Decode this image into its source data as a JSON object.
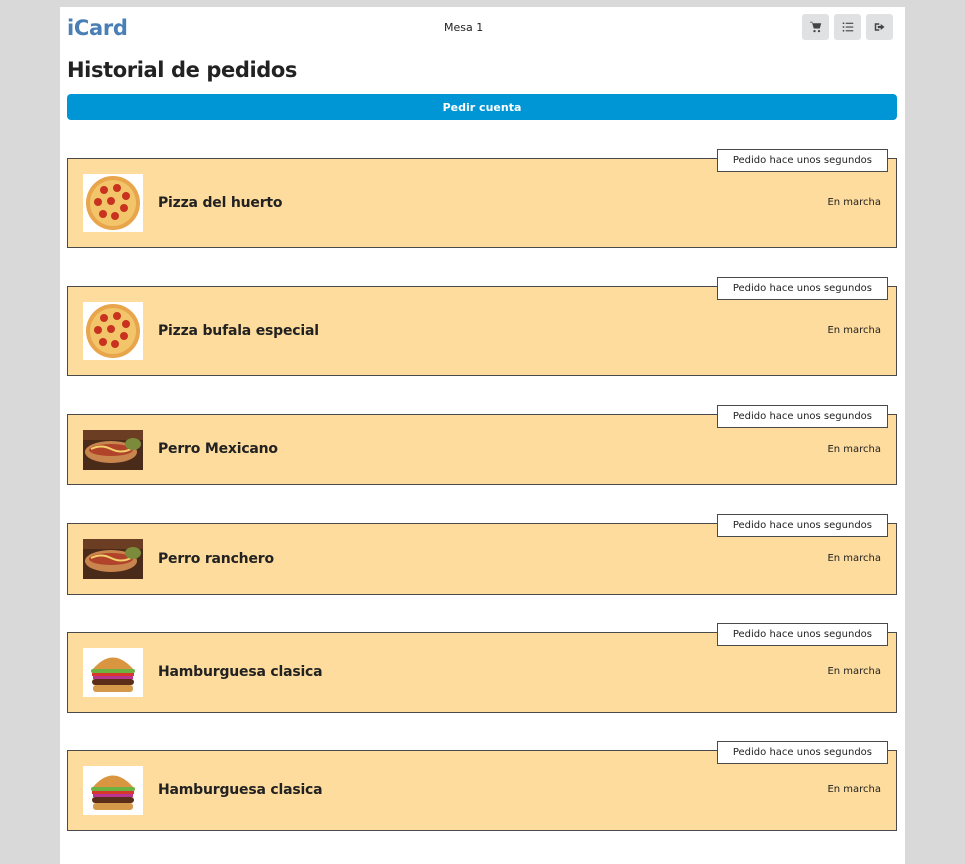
{
  "header": {
    "brand": "iCard",
    "table": "Mesa 1",
    "icons": [
      "cart-icon",
      "list-icon",
      "logout-icon"
    ]
  },
  "page_title": "Historial de pedidos",
  "pay_button_label": "Pedir cuenta",
  "orders": [
    {
      "name": "Pizza del huerto",
      "status": "En marcha",
      "time": "Pedido hace unos segundos",
      "image": "pizza"
    },
    {
      "name": "Pizza bufala especial",
      "status": "En marcha",
      "time": "Pedido hace unos segundos",
      "image": "pizza"
    },
    {
      "name": "Perro Mexicano",
      "status": "En marcha",
      "time": "Pedido hace unos segundos",
      "image": "hotdog"
    },
    {
      "name": "Perro ranchero",
      "status": "En marcha",
      "time": "Pedido hace unos segundos",
      "image": "hotdog"
    },
    {
      "name": "Hamburguesa clasica",
      "status": "En marcha",
      "time": "Pedido hace unos segundos",
      "image": "burger"
    },
    {
      "name": "Hamburguesa clasica",
      "status": "En marcha",
      "time": "Pedido hace unos segundos",
      "image": "burger"
    }
  ],
  "colors": {
    "brand": "#4a7fb5",
    "primary_button": "#0096d6",
    "order_background": "#fedc9d",
    "page_background": "#d9d9d9"
  }
}
